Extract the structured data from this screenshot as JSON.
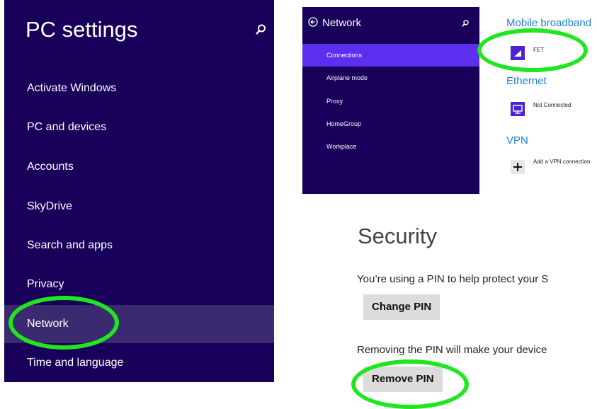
{
  "pc_settings": {
    "title": "PC settings",
    "items": [
      {
        "label": "Activate Windows"
      },
      {
        "label": "PC and devices"
      },
      {
        "label": "Accounts"
      },
      {
        "label": "SkyDrive"
      },
      {
        "label": "Search and apps"
      },
      {
        "label": "Privacy"
      },
      {
        "label": "Network"
      },
      {
        "label": "Time and language"
      }
    ]
  },
  "network": {
    "title": "Network",
    "side_items": [
      {
        "label": "Connections"
      },
      {
        "label": "Airplane mode"
      },
      {
        "label": "Proxy"
      },
      {
        "label": "HomeGroup"
      },
      {
        "label": "Workplace"
      }
    ],
    "mobile_broadband": {
      "header": "Mobile broadband",
      "connection": "FET"
    },
    "ethernet": {
      "header": "Ethernet",
      "status": "Not Connected"
    },
    "vpn": {
      "header": "VPN",
      "add_label": "Add a VPN connection"
    }
  },
  "security": {
    "heading": "Security",
    "pin_text": "You’re using a PIN to help protect your S",
    "change_pin": "Change PIN",
    "remove_text": "Removing the PIN will make your device",
    "remove_pin": "Remove PIN"
  },
  "colors": {
    "panel_bg": "#18005a",
    "selected_bg": "#5e2ef0",
    "annotation": "#1fe61f"
  }
}
